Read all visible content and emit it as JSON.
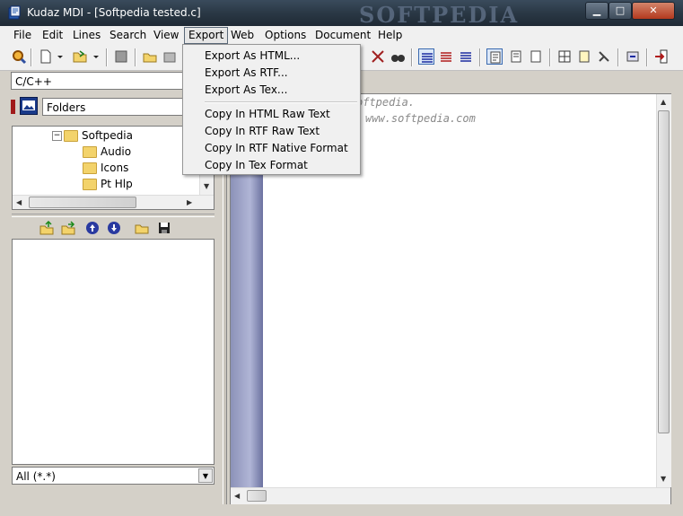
{
  "window": {
    "title": "Kudaz MDI - [Softpedia tested.c]",
    "watermark": "SOFTPEDIA"
  },
  "menubar": [
    {
      "label": "File"
    },
    {
      "label": "Edit"
    },
    {
      "label": "Lines"
    },
    {
      "label": "Search"
    },
    {
      "label": "View"
    },
    {
      "label": "Export"
    },
    {
      "label": "Web"
    },
    {
      "label": "Options"
    },
    {
      "label": "Document"
    },
    {
      "label": "Help"
    }
  ],
  "export_menu": {
    "items": [
      "Export As HTML...",
      "Export As RTF...",
      "Export As Tex...",
      "Copy In HTML Raw Text",
      "Copy In RTF Raw Text",
      "Copy In RTF Native Format",
      "Copy In Tex Format"
    ]
  },
  "left_panel": {
    "language": "C/C++",
    "folders_label": "Folders",
    "tree": [
      {
        "label": "Softpedia"
      },
      {
        "label": "Audio"
      },
      {
        "label": "Icons"
      },
      {
        "label": "Pt Hlp"
      }
    ],
    "filter": "All (*.*)"
  },
  "editor": {
    "lines": [
      "oftpedia.",
      "www.softpedia.com"
    ]
  },
  "icons": {
    "toolbar": [
      "search-icon",
      "new-file-icon",
      "open-folder-icon",
      "save-icon",
      "open-icon",
      "save-all-icon",
      "align-left-icon",
      "align-center-icon",
      "align-right-icon",
      "copy-icon",
      "paste-icon",
      "page-icon",
      "table-icon",
      "note-icon",
      "tools-icon",
      "export-icon",
      "exit-icon"
    ]
  }
}
